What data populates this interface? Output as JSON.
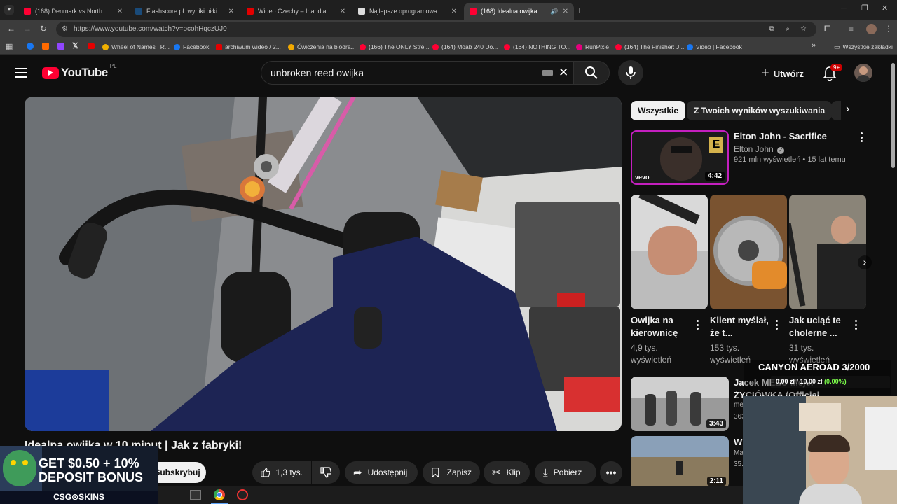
{
  "browser": {
    "tabs": [
      {
        "title": "(168) Denmark vs North Maced",
        "color": "#ff0033"
      },
      {
        "title": "Flashscore.pl: wyniki piłki nożn",
        "color": "#1a4b7a"
      },
      {
        "title": "Wideo Czechy – Irlandia. Highli",
        "color": "#e40000"
      },
      {
        "title": "Najlepsze oprogramowanie do",
        "color": "#dddddd"
      },
      {
        "title": "(168) Idealna owijka w 10 m",
        "color": "#ff0033"
      }
    ],
    "new_tab_label": "+",
    "url": "https://www.youtube.com/watch?v=ocohHqczUJ0",
    "bookmarks": [
      {
        "label": "Wheel of Names | R...",
        "color": "#f0b000"
      },
      {
        "label": "Facebook",
        "color": "#1877f2"
      },
      {
        "label": "archiwum wideo / 2...",
        "color": "#e40000"
      },
      {
        "label": "Ćwiczenia na biodra...",
        "color": "#f2a900"
      },
      {
        "label": "(166) The ONLY Stre...",
        "color": "#ff0033"
      },
      {
        "label": "(164) Moab 240 Do...",
        "color": "#ff0033"
      },
      {
        "label": "(164) NOTHING TO...",
        "color": "#ff0033"
      },
      {
        "label": "RunPixie",
        "color": "#e6007e"
      },
      {
        "label": "(164) The Finisher: J...",
        "color": "#ff0033"
      },
      {
        "label": "Video | Facebook",
        "color": "#1877f2"
      }
    ],
    "all_bookmarks_label": "Wszystkie zakładki"
  },
  "youtube": {
    "logo_text": "YouTube",
    "country": "PL",
    "search_value": "unbroken reed owijka",
    "create_label": "Utwórz",
    "notifications_badge": "9+",
    "video_title": "Idealna owijka w 10 minut | Jak z fabryki!",
    "subscribe_label": "Subskrybuj",
    "actions": {
      "likes": "1,3 tys.",
      "share": "Udostępnij",
      "save": "Zapisz",
      "clip": "Klip",
      "download": "Pobierz"
    },
    "filter_chips": [
      {
        "label": "Wszystkie"
      },
      {
        "label": "Z Twoich wyników wyszukiwania"
      }
    ],
    "recommended": [
      {
        "title": "Elton John - Sacrifice",
        "channel": "Elton John",
        "meta": "921 mln wyświetleń • 15 lat temu",
        "duration": "4:42"
      },
      {
        "title": "Jacek MEZO Mejer - ŻYCIÓWKA (Official teledysk)",
        "channel": "me...",
        "meta": "363...",
        "duration": "3:43"
      },
      {
        "title": "Wi...",
        "channel": "Ma...",
        "meta": "35...",
        "duration": "2:11"
      }
    ],
    "shorts": [
      {
        "title": "Owijka na kierownicę",
        "views": "4,9 tys.",
        "views2": "wyświetleń"
      },
      {
        "title": "Klient myślał, że t...",
        "views": "153 tys.",
        "views2": "wyświetleń"
      },
      {
        "title": "Jak uciąć te cholerne ...",
        "views": "31 tys.",
        "views2": "wyświetleń"
      }
    ]
  },
  "overlay": {
    "goal_title": "CANYON AEROAD 3/2000",
    "goal_progress": "0,00 zł / 10,00 zł",
    "goal_percent": "(0.00%)",
    "promo_line1": "GET $0.50 + 10%",
    "promo_line2": "DEPOSIT BONUS",
    "promo_brand": "CSG⊙SKINS"
  }
}
